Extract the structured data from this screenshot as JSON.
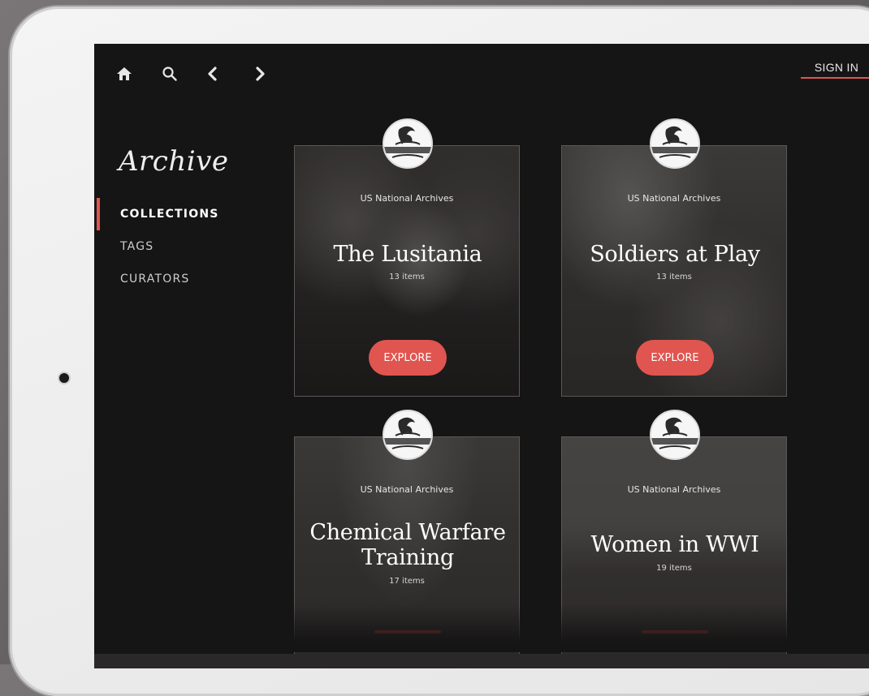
{
  "nav": {
    "home_icon": "home-icon",
    "search_icon": "search-icon",
    "back_icon": "chevron-left-icon",
    "forward_icon": "chevron-right-icon",
    "sign_in_label": "SIGN IN"
  },
  "sidebar": {
    "brand": "Archive",
    "items": [
      {
        "label": "COLLECTIONS",
        "active": true
      },
      {
        "label": "TAGS",
        "active": false
      },
      {
        "label": "CURATORS",
        "active": false
      }
    ]
  },
  "collections": [
    {
      "source": "US National Archives",
      "title": "The Lusitania",
      "count": "13  items",
      "button": "EXPLORE"
    },
    {
      "source": "US National Archives",
      "title": "Soldiers at Play",
      "count": "13  items",
      "button": "EXPLORE"
    },
    {
      "source": "US National Archives",
      "title_line1": "Chemical Warfare",
      "title_line2": "Training",
      "count": "17  items"
    },
    {
      "source": "US National Archives",
      "title": "Women in WWI",
      "count": "19  items"
    }
  ],
  "colors": {
    "accent": "#e0554f",
    "background": "#161515",
    "text": "#ffffff"
  }
}
